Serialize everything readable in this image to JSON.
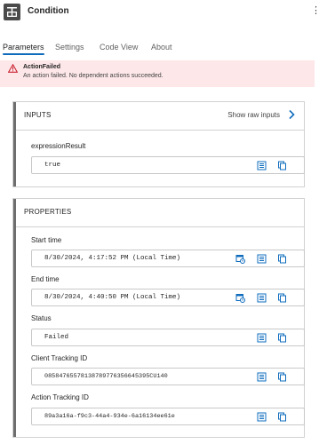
{
  "header": {
    "title": "Condition",
    "app_icon": "condition-icon",
    "more": "⋮"
  },
  "tabs": [
    {
      "label": "Parameters",
      "active": true
    },
    {
      "label": "Settings",
      "active": false
    },
    {
      "label": "Code View",
      "active": false
    },
    {
      "label": "About",
      "active": false
    }
  ],
  "error": {
    "title": "ActionFailed",
    "message": "An action failed. No dependent actions succeeded."
  },
  "inputs": {
    "title": "INPUTS",
    "raw_link": "Show raw inputs",
    "fields": [
      {
        "label": "expressionResult",
        "value": "true"
      }
    ]
  },
  "properties": {
    "title": "PROPERTIES",
    "fields": [
      {
        "label": "Start time",
        "value": "8/30/2024, 4:17:52 PM (Local Time)"
      },
      {
        "label": "End time",
        "value": "8/30/2024, 4:40:50 PM (Local Time)"
      },
      {
        "label": "Status",
        "value": "Failed"
      },
      {
        "label": "Client Tracking ID",
        "value": "08584765578138789776356645395CU140"
      },
      {
        "label": "Action Tracking ID",
        "value": "89a3a16a-f9c3-44a4-934e-6a16134ee61e"
      }
    ]
  },
  "colors": {
    "accent": "#0f6cbd",
    "error_bg": "#fde7e9",
    "error_icon": "#c50f1f"
  }
}
